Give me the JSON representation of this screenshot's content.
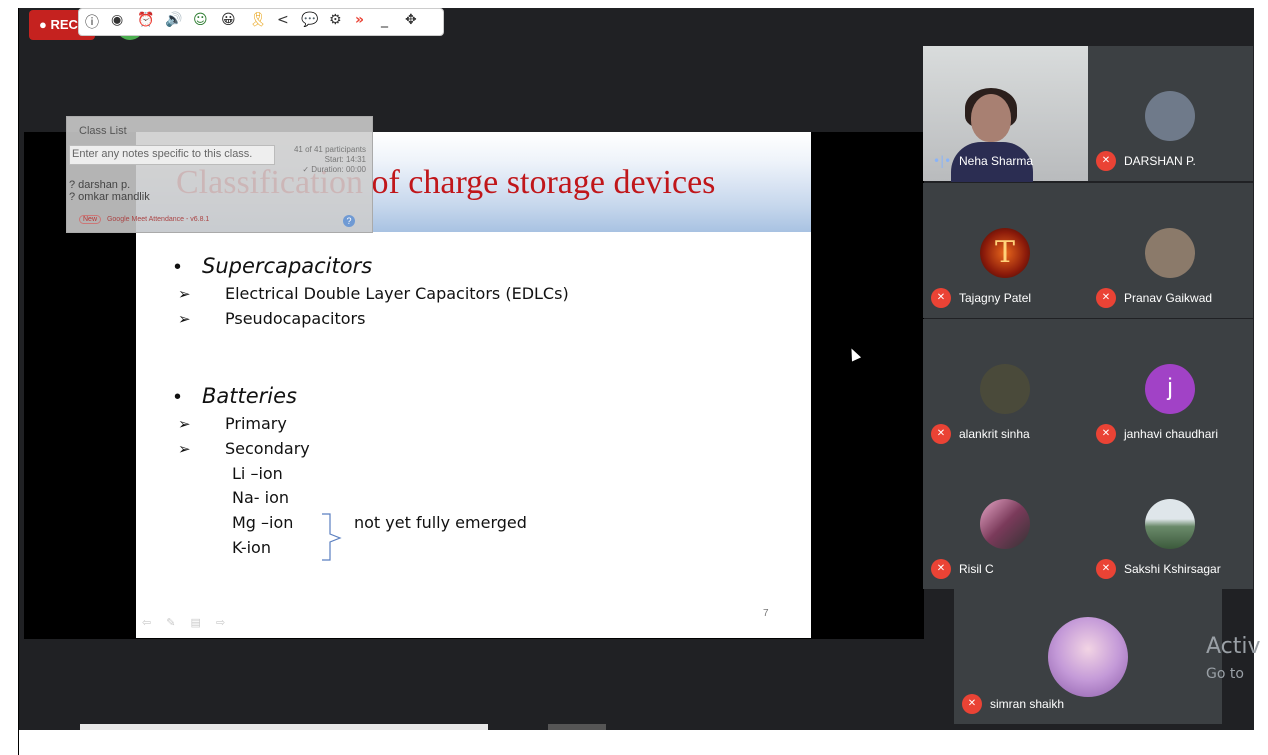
{
  "recording": {
    "label": "REC"
  },
  "toolbar": {
    "icons": [
      "ⓘ",
      "◉",
      "⏰",
      "🔊",
      "☺",
      "😀",
      "🎗",
      "<",
      "💬",
      "⚙",
      "»",
      "_",
      "✥"
    ]
  },
  "class_list": {
    "title": "Class List",
    "notes_placeholder": "Enter any notes specific to this class.",
    "count_line1": "41 of 41 participants",
    "count_line2": "Start: 14:31",
    "count_line3": "✓ Duration: 00:00",
    "names": [
      "? darshan p.",
      "? omkar mandlik"
    ],
    "footer_new": "New",
    "footer_text": "Google Meet Attendance - v6.8.1",
    "help": "?"
  },
  "slide": {
    "title": "Classification of charge storage devices",
    "section1": {
      "heading": "Supercapacitors",
      "items": [
        "Electrical Double Layer Capacitors (EDLCs)",
        "Pseudocapacitors"
      ]
    },
    "section2": {
      "heading": "Batteries",
      "items": [
        "Primary",
        "Secondary"
      ],
      "subitems": [
        "Li –ion",
        "Na- ion",
        "Mg –ion",
        "K-ion"
      ],
      "note": "not yet fully emerged"
    },
    "page_number": "7",
    "tools": "⇦ ✎ ▤ ⇨"
  },
  "participants": {
    "speaker": "Neha Sharma",
    "tiles": [
      {
        "name": "DARSHAN P.",
        "color": "#6f7a8a"
      },
      {
        "name": "Tajagny Patel",
        "color": "#8b1a0a"
      },
      {
        "name": "Pranav Gaikwad",
        "color": "#8b7a6a"
      },
      {
        "name": "alankrit sinha",
        "color": "#4a4a3a"
      },
      {
        "name": "janhavi chaudhari",
        "color": "#a142c6",
        "initial": "j"
      },
      {
        "name": "Risil C",
        "color": "#7a3a5a"
      },
      {
        "name": "Sakshi Kshirsagar",
        "color": "#6a8a6a"
      },
      {
        "name": "simran shaikh",
        "color": "#c49ad8"
      }
    ]
  },
  "watermark": {
    "line1": "Activ",
    "line2": "Go to"
  }
}
